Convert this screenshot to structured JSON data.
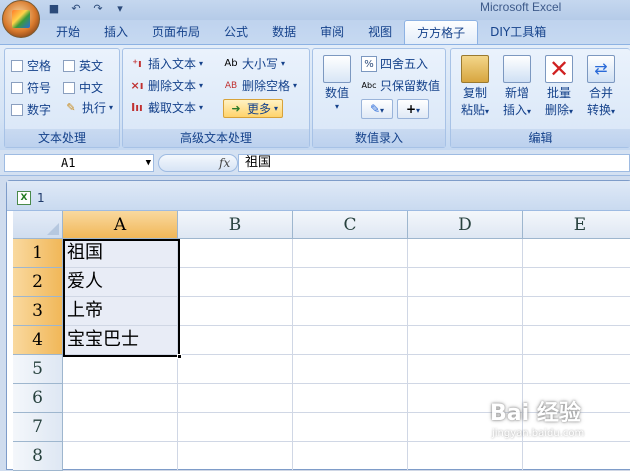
{
  "app_title": "Microsoft Excel",
  "quick_access": [
    "save-icon",
    "undo-icon",
    "redo-icon",
    "customize-icon"
  ],
  "tabs": [
    {
      "label": "开始",
      "active": false
    },
    {
      "label": "插入",
      "active": false
    },
    {
      "label": "页面布局",
      "active": false
    },
    {
      "label": "公式",
      "active": false
    },
    {
      "label": "数据",
      "active": false
    },
    {
      "label": "审阅",
      "active": false
    },
    {
      "label": "视图",
      "active": false
    },
    {
      "label": "方方格子",
      "active": true
    },
    {
      "label": "DIY工具箱",
      "active": false
    }
  ],
  "ribbon": {
    "text_group": {
      "label": "文本处理",
      "options": [
        "空格",
        "英文",
        "符号",
        "中文",
        "数字"
      ],
      "execute": "执行"
    },
    "advanced_group": {
      "label": "高级文本处理",
      "insert_text": "插入文本",
      "delete_text": "删除文本",
      "extract_text": "截取文本",
      "case": "大小写",
      "delete_space": "删除空格",
      "more": "更多",
      "case_icon": "Ab",
      "space_icon": "AB"
    },
    "numeric_group": {
      "label": "数值录入",
      "numeric": "数值",
      "round": "四舍五入",
      "keep_value": "只保留数值",
      "round_icon": "%",
      "keep_icon": "Abc",
      "plus_icon": "+"
    },
    "edit_group": {
      "label": "编辑",
      "copy": "复制",
      "paste": "粘贴",
      "new": "新增",
      "insert": "插入",
      "batch": "批量",
      "delete": "删除",
      "merge": "合并",
      "convert": "转换"
    }
  },
  "formula_bar": {
    "name_box": "A1",
    "fx": "fx",
    "content": "祖国"
  },
  "workbook": {
    "title": "1",
    "icon_text": "X",
    "columns": [
      "A",
      "B",
      "C",
      "D",
      "E"
    ],
    "rows": [
      "1",
      "2",
      "3",
      "4",
      "5",
      "6",
      "7",
      "8"
    ],
    "cells_A": [
      "祖国",
      "爱人",
      "上帝",
      "宝宝巴士",
      "",
      "",
      "",
      ""
    ],
    "selected_column": "A",
    "selected_rows": [
      "1",
      "2",
      "3",
      "4"
    ]
  },
  "watermark": {
    "text": "Bai 经验",
    "sub": "jingyan.baidu.com"
  }
}
